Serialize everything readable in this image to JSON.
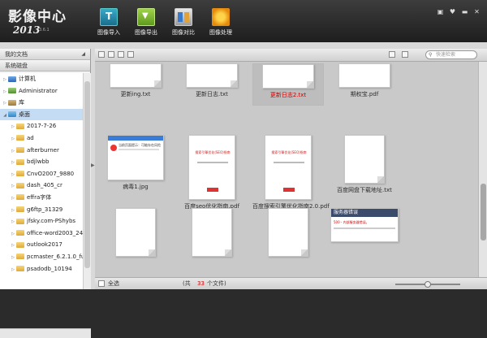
{
  "app": {
    "name": "影像中心",
    "year": "2013",
    "version": "3.6.1"
  },
  "toolbar": [
    {
      "label": "图像导入",
      "icon": "import-icon"
    },
    {
      "label": "图像导出",
      "icon": "export-icon"
    },
    {
      "label": "图像对比",
      "icon": "compare-icon"
    },
    {
      "label": "图像处理",
      "icon": "process-icon"
    }
  ],
  "sidebar": {
    "my_docs": "我的文档",
    "system_disk": "系统磁盘",
    "tree": [
      {
        "label": "计算机",
        "icon": "pc",
        "exp": "▷"
      },
      {
        "label": "Administrator",
        "icon": "user",
        "exp": "▷"
      },
      {
        "label": "库",
        "icon": "lib",
        "exp": "▷"
      },
      {
        "label": "桌面",
        "icon": "desk",
        "exp": "◢",
        "selected": true
      },
      {
        "label": "2017-7-26",
        "icon": "folder",
        "exp": "▷"
      },
      {
        "label": "ad",
        "icon": "folder",
        "exp": "▷"
      },
      {
        "label": "afterburner",
        "icon": "folder",
        "exp": "▷"
      },
      {
        "label": "bdjlwbb",
        "icon": "folder",
        "exp": "▷"
      },
      {
        "label": "CnvO2007_9880",
        "icon": "folder",
        "exp": "▷"
      },
      {
        "label": "dash_405_cr",
        "icon": "folder",
        "exp": "▷"
      },
      {
        "label": "effra字体",
        "icon": "folder",
        "exp": "▷"
      },
      {
        "label": "g6ftp_31329",
        "icon": "folder",
        "exp": "▷"
      },
      {
        "label": "jfsky.com-PShybs",
        "icon": "folder",
        "exp": "▷"
      },
      {
        "label": "office-word2003_24",
        "icon": "folder",
        "exp": "▷"
      },
      {
        "label": "outlook2017",
        "icon": "folder",
        "exp": "▷"
      },
      {
        "label": "pcmaster_6.2.1.0_fu",
        "icon": "folder",
        "exp": "▷"
      },
      {
        "label": "psadodb_10194",
        "icon": "folder",
        "exp": "▷"
      }
    ]
  },
  "search": {
    "placeholder": "快速检索"
  },
  "files": [
    {
      "name": "更新ing.txt"
    },
    {
      "name": "更新日志.txt"
    },
    {
      "name": "更新日志2.txt",
      "selected": true
    },
    {
      "name": "期权宝.pdf"
    },
    {
      "name": "病毒1.jpg"
    },
    {
      "name": "百度seo优化指南.pdf"
    },
    {
      "name": "百度搜索引擎优化指南2.0.pdf"
    },
    {
      "name": "百度网盘下载地址.txt"
    },
    {
      "name": ""
    },
    {
      "name": ""
    },
    {
      "name": ""
    },
    {
      "name": ""
    }
  ],
  "thumb_texts": {
    "virus_header": "当前页面提示：可能存在风险",
    "seo_title": "搜索引擎优化(SEO)指南",
    "error_title": "服务器错误",
    "error_code": "500 - 内部服务器错误。"
  },
  "footer": {
    "select_all": "全选",
    "count_prefix": "(共",
    "count": "33",
    "count_suffix": "个文件)"
  }
}
